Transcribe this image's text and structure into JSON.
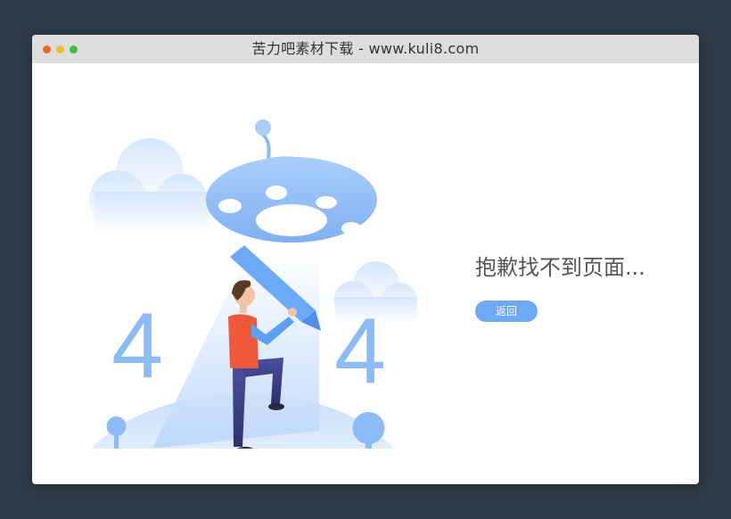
{
  "window": {
    "title": "苦力吧素材下载 - www.kuli8.com"
  },
  "error": {
    "code_digit_left": "4",
    "code_digit_right": "4",
    "message": "抱歉找不到页面...",
    "back_label": "返回"
  },
  "colors": {
    "page_background": "#2c3b47",
    "titlebar": "#dddddd",
    "accent": "#6ca9f7",
    "illustration_blue": "#8bbcf7",
    "shirt": "#f05a3a",
    "pants": "#3a3f86"
  },
  "icons": [
    "close-dot",
    "minimize-dot",
    "maximize-dot"
  ]
}
